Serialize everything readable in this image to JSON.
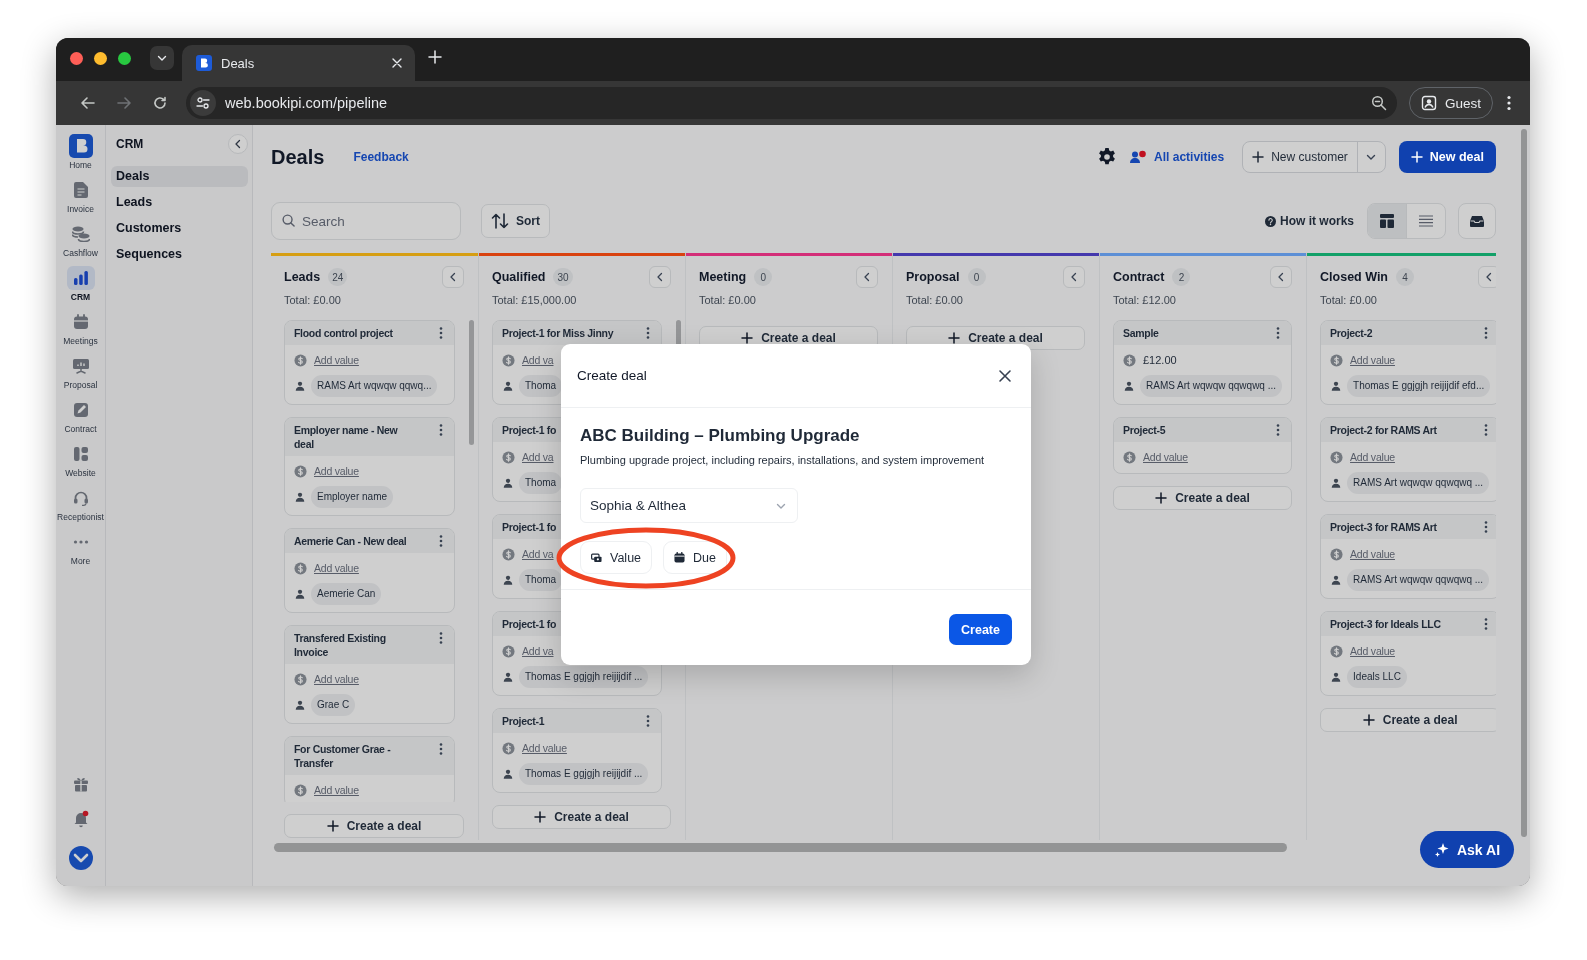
{
  "browser": {
    "tab_title": "Deals",
    "url": "web.bookipi.com/pipeline",
    "profile": "Guest"
  },
  "nav_rail": {
    "items": [
      {
        "label": "Home",
        "selected": false
      },
      {
        "label": "Invoice",
        "selected": false
      },
      {
        "label": "Cashflow",
        "selected": false
      },
      {
        "label": "CRM",
        "selected": true
      },
      {
        "label": "Meetings",
        "selected": false
      },
      {
        "label": "Proposal",
        "selected": false
      },
      {
        "label": "Contract",
        "selected": false
      },
      {
        "label": "Website",
        "selected": false
      },
      {
        "label": "Receptionist",
        "selected": false
      },
      {
        "label": "More",
        "selected": false
      }
    ]
  },
  "crm_menu": {
    "title": "CRM",
    "items": [
      {
        "label": "Deals",
        "selected": true
      },
      {
        "label": "Leads",
        "selected": false
      },
      {
        "label": "Customers",
        "selected": false
      },
      {
        "label": "Sequences",
        "selected": false
      }
    ]
  },
  "header": {
    "title": "Deals",
    "feedback": "Feedback",
    "activities": "All activities",
    "new_customer": "New customer",
    "new_deal": "New deal"
  },
  "toolbar": {
    "search_placeholder": "Search",
    "sort": "Sort",
    "how_it_works": "How it works",
    "views": [
      {
        "selected": true
      },
      {
        "selected": false
      }
    ]
  },
  "columns": [
    {
      "name": "Leads",
      "count": "24",
      "total": "Total: £0.00",
      "color": "#d69e12",
      "create": "Create a deal",
      "cards": [
        {
          "title": "Flood control project",
          "menu": true,
          "value": "Add value",
          "value_set": false,
          "contact": "RAMS Art wqwqw qqwq..."
        },
        {
          "title": "Employer name - New deal",
          "menu": true,
          "value": "Add value",
          "value_set": false,
          "contact": "Employer name"
        },
        {
          "title": "Aemerie Can - New deal",
          "menu": true,
          "value": "Add value",
          "value_set": false,
          "contact": "Aemerie Can"
        },
        {
          "title": "Transfered Existing Invoice",
          "menu": true,
          "value": "Add value",
          "value_set": false,
          "contact": "Grae C"
        },
        {
          "title": "For Customer Grae - Transfer",
          "menu": true,
          "value": "Add value",
          "value_set": false
        }
      ]
    },
    {
      "name": "Qualified",
      "count": "30",
      "total": "Total: £15,000.00",
      "color": "#d9420f",
      "create": "Create a deal",
      "cards": [
        {
          "title": "Project-1 for Miss Jinny",
          "menu": true,
          "value": "Add va",
          "value_set": false,
          "contact": "Thoma"
        },
        {
          "title": "Project-1 fo",
          "menu": false,
          "value": "Add va",
          "value_set": false,
          "contact": "Thoma"
        },
        {
          "title": "Project-1 fo",
          "menu": false,
          "value": "Add va",
          "value_set": false,
          "contact": "Thoma"
        },
        {
          "title": "Project-1 fo",
          "menu": false,
          "value": "Add va",
          "value_set": false,
          "contact": "Thomas E ggjgjh reijijdif ..."
        },
        {
          "title": "Project-1",
          "menu": true,
          "value": "Add value",
          "value_set": false,
          "contact": "Thomas E ggjgjh reijijdif ..."
        }
      ]
    },
    {
      "name": "Meeting",
      "count": "0",
      "total": "Total: £0.00",
      "color": "#d32e78",
      "create": "Create a deal"
    },
    {
      "name": "Proposal",
      "count": "0",
      "total": "Total: £0.00",
      "color": "#4438ad",
      "create": "Create a deal"
    },
    {
      "name": "Contract",
      "count": "2",
      "total": "Total: £12.00",
      "color": "#5c8fd6",
      "create": "Create a deal",
      "cards": [
        {
          "title": "Sample",
          "menu": true,
          "value": "£12.00",
          "value_set": true,
          "contact": "RAMS Art wqwqw qqwqwq ..."
        },
        {
          "title": "Project-5",
          "menu": true,
          "value": "Add value",
          "value_set": false
        }
      ]
    },
    {
      "name": "Closed Win",
      "count": "4",
      "total": "Total: £0.00",
      "color": "#12a068",
      "create": "Create a deal",
      "cards": [
        {
          "title": "Project-2",
          "menu": true,
          "value": "Add value",
          "value_set": false,
          "contact": "Thomas E ggjgjh reijijdif efd..."
        },
        {
          "title": "Project-2 for RAMS Art",
          "menu": true,
          "value": "Add value",
          "value_set": false,
          "contact": "RAMS Art wqwqw qqwqwq ..."
        },
        {
          "title": "Project-3 for RAMS Art",
          "menu": true,
          "value": "Add value",
          "value_set": false,
          "contact": "RAMS Art wqwqw qqwqwq ..."
        },
        {
          "title": "Project-3 for Ideals LLC",
          "menu": true,
          "value": "Add value",
          "value_set": false,
          "contact": "Ideals LLC"
        }
      ]
    }
  ],
  "modal": {
    "title": "Create deal",
    "deal_name": "ABC Building – Plumbing Upgrade",
    "description": "Plumbing upgrade project, including repairs, installations, and system improvement",
    "customer": "Sophia & Althea",
    "chips": [
      "Value",
      "Due"
    ],
    "create": "Create"
  },
  "ask_ai": "Ask AI"
}
